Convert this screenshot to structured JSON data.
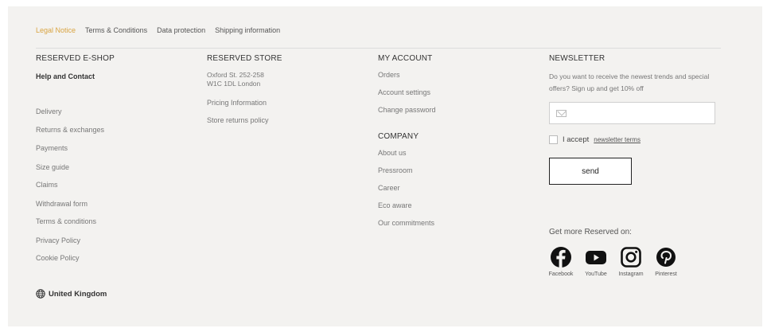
{
  "legal_links": [
    {
      "label": "Legal Notice",
      "active": true
    },
    {
      "label": "Terms & Conditions",
      "active": false
    },
    {
      "label": "Data protection",
      "active": false
    },
    {
      "label": "Shipping information",
      "active": false
    }
  ],
  "eshop": {
    "title": "RESERVED E-SHOP",
    "help": "Help and Contact",
    "links": [
      "Delivery",
      "Returns & exchanges",
      "Payments",
      "Size guide",
      "Claims",
      "Withdrawal form",
      "Terms & conditions",
      "Privacy Policy",
      "Cookie Policy"
    ]
  },
  "store": {
    "title": "RESERVED STORE",
    "address_line1": "Oxford St. 252-258",
    "address_line2": "W1C 1DL London",
    "links": [
      "Pricing Information",
      "Store returns policy"
    ]
  },
  "account": {
    "title": "MY ACCOUNT",
    "links": [
      "Orders",
      "Account settings",
      "Change password"
    ]
  },
  "company": {
    "title": "COMPANY",
    "links": [
      "About us",
      "Pressroom",
      "Career",
      "Eco aware",
      "Our commitments"
    ]
  },
  "newsletter": {
    "title": "NEWSLETTER",
    "text": "Do you want to receive the newest trends and special offers? Sign up and get 10% off",
    "email_placeholder": "",
    "accept_prefix": "I accept",
    "accept_link": "newsletter terms",
    "send_label": "send"
  },
  "social": {
    "heading": "Get more Reserved on:",
    "items": [
      {
        "label": "Facebook",
        "icon": "facebook-icon"
      },
      {
        "label": "YouTube",
        "icon": "youtube-icon"
      },
      {
        "label": "Instagram",
        "icon": "instagram-icon"
      },
      {
        "label": "Pinterest",
        "icon": "pinterest-icon"
      }
    ]
  },
  "country": "United Kingdom",
  "colors": {
    "accent": "#d9a441",
    "background": "#f3f2f0"
  }
}
